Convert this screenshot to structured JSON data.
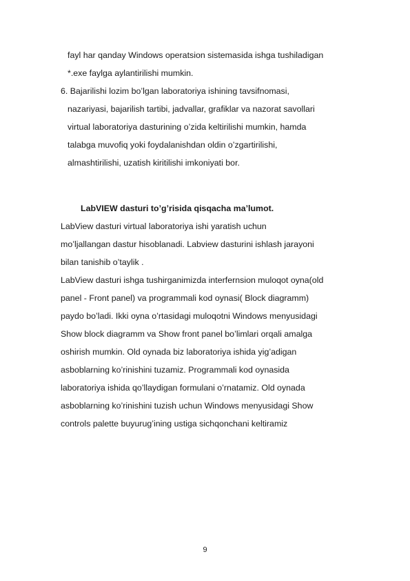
{
  "document": {
    "lines_top": [
      "fayl har qanday Windows operatsion sistemasida ishga tushiladigan",
      "*.exe faylga aylantirilishi mumkin."
    ],
    "item6": [
      "6. Bajarilishi lozim bo’lgan laboratoriya ishining tavsifnomasi,",
      "nazariyasi, bajarilish tartibi, jadvallar, grafiklar va nazorat savollari",
      "virtual laboratoriya dasturining o’zida keltirilishi mumkin, hamda",
      "talabga muvofiq yoki foydalanishdan oldin o’zgartirilishi,",
      "almashtirilishi, uzatish kiritilishi imkoniyati bor."
    ],
    "heading": "LabVIEW  dasturi to’g’risida  qisqacha  ma’lumot.",
    "para1": [
      "LabView  dasturi  virtual   laboratoriya  ishi  yaratish  uchun",
      "mo’ljallangan dastur hisoblanadi.  Labview dasturini ishlash jarayoni",
      "bilan tanishib o’taylik ."
    ],
    "para2": [
      "LabView  dasturi ishga  tushirganimizda interfernsion muloqot oyna(old",
      "panel  - Front panel) va    programmali  kod  oynasi( Block diagramm)",
      "paydo bo’ladi.  Ikki oyna o’rtasidagi  muloqotni Windows  menyusidagi",
      "Show block  diagramm va  Show front panel  bo’limlari orqali amalga",
      "oshirish  mumkin.  Old oynada  biz  laboratoriya ishida yig’adigan",
      "asboblarning ko’rinishini tuzamiz. Programmali  kod oynasida",
      "laboratoriya ishida qo’llaydigan  formulani o’rnatamiz.    Old oynada",
      "asboblarning ko’rinishini  tuzish uchun   Windows menyusidagi  Show",
      "controls  palette buyurug’ining ustiga sichqonchani  keltiramiz"
    ],
    "page_number": "9"
  }
}
